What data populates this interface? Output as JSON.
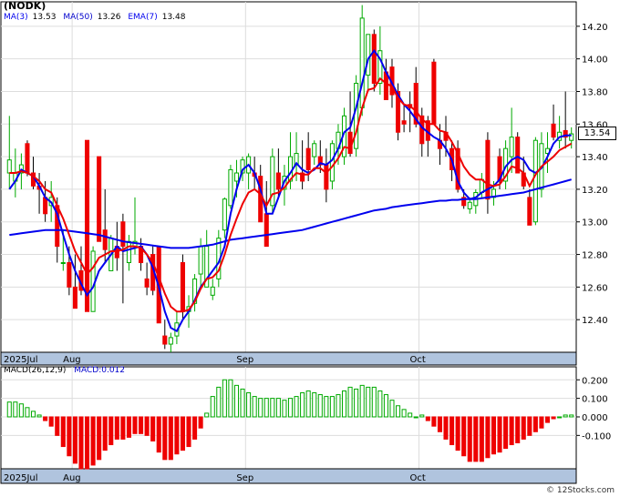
{
  "title": "(NODK)",
  "legend": {
    "ma3_label": "MA(3)",
    "ma3_value": "13.53",
    "ma50_label": "MA(50)",
    "ma50_value": "13.26",
    "ema7_label": "EMA(7)",
    "ema7_value": "13.48"
  },
  "last_price": "13.54",
  "macd_legend": {
    "params": "MACD(26,12,9)",
    "value": "MACD:0.012"
  },
  "copyright": "© 12Stocks.com",
  "colors": {
    "up": "#00aa00",
    "down": "#ee0000",
    "ma_fast": "#0000ee",
    "ma_slow": "#0000cc",
    "ema": "#ee0000",
    "axis_band": "#b0c4de",
    "grid": "#dddddd"
  },
  "chart_data": {
    "type": "candlestick",
    "price_axis": {
      "ylim": [
        12.2,
        14.35
      ],
      "ticks": [
        "12.40",
        "12.60",
        "12.80",
        "13.00",
        "13.20",
        "13.40",
        "13.60",
        "13.80",
        "14.00",
        "14.20"
      ]
    },
    "macd_axis": {
      "ylim": [
        -0.28,
        0.27
      ],
      "ticks": [
        "0.200",
        "0.100",
        "0.000",
        "-0.100"
      ]
    },
    "x_axis_labels": [
      {
        "index": 0,
        "label": "2025Jul"
      },
      {
        "index": 11,
        "label": "Aug"
      },
      {
        "index": 40,
        "label": "Sep"
      },
      {
        "index": 69,
        "label": "Oct"
      }
    ],
    "candles": [
      [
        13.3,
        13.65,
        13.2,
        13.38
      ],
      [
        13.25,
        13.45,
        13.15,
        13.3
      ],
      [
        13.3,
        13.42,
        13.2,
        13.35
      ],
      [
        13.48,
        13.5,
        13.28,
        13.3
      ],
      [
        13.3,
        13.4,
        13.2,
        13.22
      ],
      [
        13.22,
        13.3,
        13.05,
        13.2
      ],
      [
        13.15,
        13.25,
        13.0,
        13.05
      ],
      [
        13.1,
        13.25,
        13.0,
        13.15
      ],
      [
        13.1,
        13.15,
        12.75,
        12.85
      ],
      [
        12.75,
        12.95,
        12.7,
        12.75
      ],
      [
        12.75,
        12.85,
        12.55,
        12.6
      ],
      [
        12.6,
        12.8,
        12.48,
        12.47
      ],
      [
        12.7,
        12.85,
        12.55,
        12.58
      ],
      [
        13.5,
        13.5,
        12.45,
        12.45
      ],
      [
        12.45,
        12.85,
        12.45,
        12.82
      ],
      [
        13.4,
        13.4,
        12.88,
        12.88
      ],
      [
        12.95,
        13.2,
        12.75,
        12.83
      ],
      [
        12.7,
        12.92,
        12.7,
        12.9
      ],
      [
        12.85,
        13.0,
        12.7,
        12.78
      ],
      [
        13.0,
        13.05,
        12.5,
        12.85
      ],
      [
        12.75,
        12.92,
        12.7,
        12.88
      ],
      [
        12.85,
        13.15,
        12.8,
        12.88
      ],
      [
        12.85,
        12.9,
        12.7,
        12.75
      ],
      [
        12.65,
        12.75,
        12.55,
        12.6
      ],
      [
        12.8,
        12.85,
        12.55,
        12.58
      ],
      [
        12.85,
        12.85,
        12.45,
        12.38
      ],
      [
        12.3,
        12.4,
        12.22,
        12.25
      ],
      [
        12.25,
        12.32,
        12.2,
        12.29
      ],
      [
        12.3,
        12.45,
        12.25,
        12.38
      ],
      [
        12.75,
        12.8,
        12.4,
        12.45
      ],
      [
        12.45,
        12.55,
        12.35,
        12.48
      ],
      [
        12.5,
        12.68,
        12.45,
        12.65
      ],
      [
        12.68,
        12.9,
        12.6,
        12.85
      ],
      [
        12.6,
        12.95,
        12.6,
        12.85
      ],
      [
        12.55,
        12.65,
        12.52,
        12.6
      ],
      [
        12.65,
        12.95,
        12.6,
        12.9
      ],
      [
        12.95,
        13.15,
        12.9,
        13.14
      ],
      [
        13.1,
        13.35,
        13.08,
        13.32
      ],
      [
        13.25,
        13.38,
        13.15,
        13.3
      ],
      [
        13.3,
        13.4,
        13.25,
        13.38
      ],
      [
        13.3,
        13.42,
        13.2,
        13.4
      ],
      [
        13.3,
        13.4,
        13.2,
        13.28
      ],
      [
        13.28,
        13.35,
        13.05,
        13.0
      ],
      [
        13.05,
        13.25,
        12.85,
        12.85
      ],
      [
        13.1,
        13.45,
        13.05,
        13.4
      ],
      [
        13.3,
        13.45,
        13.15,
        13.2
      ],
      [
        13.2,
        13.35,
        13.1,
        13.28
      ],
      [
        13.25,
        13.55,
        13.2,
        13.4
      ],
      [
        13.35,
        13.55,
        13.25,
        13.42
      ],
      [
        13.3,
        13.5,
        13.2,
        13.25
      ],
      [
        13.45,
        13.55,
        13.25,
        13.32
      ],
      [
        13.4,
        13.5,
        13.35,
        13.48
      ],
      [
        13.4,
        13.5,
        13.3,
        13.35
      ],
      [
        13.35,
        13.45,
        13.12,
        13.2
      ],
      [
        13.25,
        13.5,
        13.2,
        13.48
      ],
      [
        13.45,
        13.6,
        13.35,
        13.55
      ],
      [
        13.4,
        13.7,
        13.35,
        13.65
      ],
      [
        13.55,
        13.8,
        13.4,
        13.42
      ],
      [
        13.45,
        13.9,
        13.4,
        13.85
      ],
      [
        13.7,
        14.33,
        13.65,
        14.25
      ],
      [
        13.9,
        14.15,
        13.8,
        14.15
      ],
      [
        14.15,
        14.18,
        13.8,
        13.85
      ],
      [
        13.85,
        14.2,
        13.78,
        14.05
      ],
      [
        13.92,
        14.0,
        13.75,
        13.75
      ],
      [
        13.95,
        14.0,
        13.7,
        13.78
      ],
      [
        13.8,
        13.85,
        13.5,
        13.55
      ],
      [
        13.62,
        13.72,
        13.55,
        13.6
      ],
      [
        13.72,
        13.8,
        13.55,
        13.7
      ],
      [
        13.85,
        13.95,
        13.58,
        13.6
      ],
      [
        13.65,
        13.7,
        13.4,
        13.48
      ],
      [
        13.62,
        13.65,
        13.4,
        13.5
      ],
      [
        13.98,
        14.0,
        13.6,
        13.6
      ],
      [
        13.5,
        13.6,
        13.35,
        13.45
      ],
      [
        13.55,
        13.65,
        13.4,
        13.5
      ],
      [
        13.45,
        13.5,
        13.25,
        13.32
      ],
      [
        13.45,
        13.5,
        13.18,
        13.2
      ],
      [
        13.15,
        13.2,
        13.08,
        13.1
      ],
      [
        13.08,
        13.15,
        13.05,
        13.12
      ],
      [
        13.1,
        13.2,
        13.05,
        13.18
      ],
      [
        13.18,
        13.3,
        13.15,
        13.26
      ],
      [
        13.5,
        13.55,
        13.05,
        13.14
      ],
      [
        13.15,
        13.25,
        13.1,
        13.2
      ],
      [
        13.4,
        13.45,
        13.2,
        13.25
      ],
      [
        13.25,
        13.5,
        13.2,
        13.45
      ],
      [
        13.4,
        13.7,
        13.3,
        13.52
      ],
      [
        13.52,
        13.55,
        13.3,
        13.3
      ],
      [
        13.3,
        13.4,
        13.2,
        13.22
      ],
      [
        13.15,
        13.2,
        12.98,
        12.98
      ],
      [
        13.0,
        13.52,
        12.98,
        13.5
      ],
      [
        13.2,
        13.55,
        13.15,
        13.48
      ],
      [
        13.42,
        13.55,
        13.3,
        13.45
      ],
      [
        13.6,
        13.72,
        13.5,
        13.52
      ],
      [
        13.5,
        13.65,
        13.45,
        13.55
      ],
      [
        13.56,
        13.8,
        13.45,
        13.52
      ],
      [
        13.5,
        13.58,
        13.45,
        13.54
      ]
    ],
    "series": [
      {
        "name": "MA(3)",
        "values": [
          13.2,
          13.25,
          13.32,
          13.3,
          13.28,
          13.22,
          13.15,
          13.12,
          13.05,
          12.92,
          12.8,
          12.7,
          12.62,
          12.55,
          12.6,
          12.7,
          12.75,
          12.8,
          12.85,
          12.82,
          12.83,
          12.84,
          12.85,
          12.8,
          12.72,
          12.6,
          12.45,
          12.35,
          12.33,
          12.4,
          12.45,
          12.52,
          12.6,
          12.65,
          12.7,
          12.75,
          12.85,
          13.05,
          13.2,
          13.32,
          13.35,
          13.3,
          13.2,
          13.05,
          13.05,
          13.15,
          13.25,
          13.3,
          13.36,
          13.32,
          13.3,
          13.32,
          13.36,
          13.35,
          13.38,
          13.45,
          13.55,
          13.58,
          13.7,
          13.85,
          14.0,
          14.05,
          14.0,
          13.92,
          13.85,
          13.78,
          13.72,
          13.68,
          13.63,
          13.58,
          13.55,
          13.52,
          13.5,
          13.45,
          13.38,
          13.25,
          13.18,
          13.14,
          13.15,
          13.18,
          13.2,
          13.22,
          13.26,
          13.34,
          13.38,
          13.4,
          13.38,
          13.32,
          13.3,
          13.33,
          13.4,
          13.48,
          13.52,
          13.53,
          13.53
        ]
      },
      {
        "name": "MA(50)",
        "values": [
          12.92,
          12.925,
          12.93,
          12.935,
          12.94,
          12.945,
          12.95,
          12.95,
          12.95,
          12.95,
          12.945,
          12.94,
          12.935,
          12.93,
          12.925,
          12.92,
          12.91,
          12.9,
          12.89,
          12.88,
          12.875,
          12.87,
          12.865,
          12.86,
          12.855,
          12.85,
          12.845,
          12.84,
          12.84,
          12.84,
          12.84,
          12.845,
          12.85,
          12.855,
          12.86,
          12.87,
          12.88,
          12.89,
          12.895,
          12.9,
          12.905,
          12.91,
          12.915,
          12.92,
          12.925,
          12.93,
          12.935,
          12.94,
          12.945,
          12.95,
          12.96,
          12.97,
          12.98,
          12.99,
          13.0,
          13.01,
          13.02,
          13.03,
          13.04,
          13.05,
          13.06,
          13.07,
          13.075,
          13.08,
          13.09,
          13.095,
          13.1,
          13.105,
          13.11,
          13.115,
          13.12,
          13.125,
          13.13,
          13.13,
          13.135,
          13.135,
          13.14,
          13.14,
          13.14,
          13.145,
          13.15,
          13.155,
          13.16,
          13.165,
          13.17,
          13.175,
          13.18,
          13.19,
          13.2,
          13.21,
          13.22,
          13.23,
          13.24,
          13.25,
          13.26
        ]
      },
      {
        "name": "EMA(7)",
        "values": [
          13.3,
          13.3,
          13.31,
          13.3,
          13.28,
          13.25,
          13.2,
          13.18,
          13.1,
          13.02,
          12.92,
          12.82,
          12.75,
          12.68,
          12.72,
          12.78,
          12.8,
          12.82,
          12.82,
          12.83,
          12.85,
          12.85,
          12.84,
          12.8,
          12.75,
          12.66,
          12.56,
          12.48,
          12.45,
          12.45,
          12.46,
          12.51,
          12.59,
          12.65,
          12.66,
          12.7,
          12.8,
          12.92,
          13.02,
          13.11,
          13.18,
          13.2,
          13.17,
          13.1,
          13.17,
          13.18,
          13.21,
          13.26,
          13.3,
          13.29,
          13.29,
          13.33,
          13.33,
          13.3,
          13.34,
          13.39,
          13.46,
          13.45,
          13.55,
          13.7,
          13.81,
          13.82,
          13.88,
          13.85,
          13.83,
          13.76,
          13.72,
          13.71,
          13.68,
          13.63,
          13.6,
          13.6,
          13.56,
          13.55,
          13.49,
          13.42,
          13.34,
          13.29,
          13.26,
          13.26,
          13.23,
          13.22,
          13.23,
          13.28,
          13.34,
          13.33,
          13.3,
          13.22,
          13.29,
          13.34,
          13.37,
          13.4,
          13.44,
          13.46,
          13.48
        ]
      }
    ],
    "macd_histogram": [
      0.08,
      0.08,
      0.07,
      0.05,
      0.03,
      0.01,
      -0.02,
      -0.05,
      -0.1,
      -0.16,
      -0.21,
      -0.25,
      -0.28,
      -0.28,
      -0.26,
      -0.23,
      -0.18,
      -0.15,
      -0.12,
      -0.12,
      -0.11,
      -0.09,
      -0.09,
      -0.1,
      -0.13,
      -0.19,
      -0.23,
      -0.23,
      -0.2,
      -0.18,
      -0.16,
      -0.12,
      -0.06,
      0.02,
      0.11,
      0.16,
      0.2,
      0.2,
      0.17,
      0.15,
      0.13,
      0.11,
      0.1,
      0.1,
      0.1,
      0.1,
      0.09,
      0.1,
      0.11,
      0.13,
      0.14,
      0.13,
      0.12,
      0.11,
      0.11,
      0.12,
      0.14,
      0.16,
      0.15,
      0.17,
      0.16,
      0.16,
      0.14,
      0.12,
      0.09,
      0.06,
      0.04,
      0.02,
      0.0,
      0.01,
      -0.02,
      -0.05,
      -0.08,
      -0.12,
      -0.15,
      -0.18,
      -0.21,
      -0.24,
      -0.24,
      -0.24,
      -0.22,
      -0.2,
      -0.19,
      -0.17,
      -0.15,
      -0.14,
      -0.12,
      -0.1,
      -0.08,
      -0.06,
      -0.03,
      -0.01,
      0.0,
      0.01,
      0.01
    ]
  }
}
